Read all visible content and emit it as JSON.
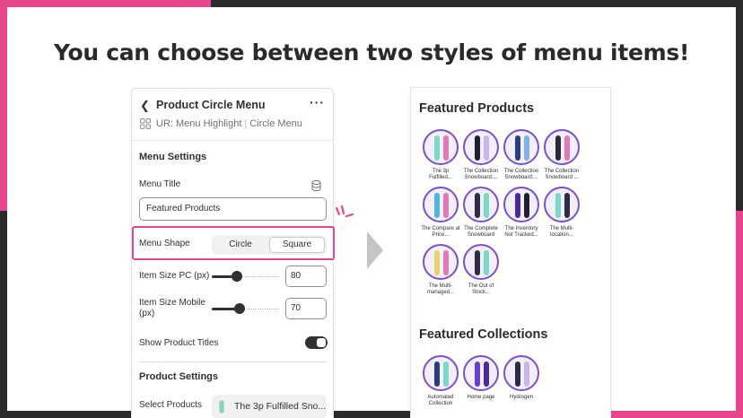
{
  "headline": "You can choose between two styles of menu items!",
  "panel": {
    "title": "Product Circle Menu",
    "subtitle_app": "UR: Menu Highlight",
    "subtitle_block": "Circle Menu",
    "menu_settings": "Menu Settings",
    "menu_title_label": "Menu Title",
    "menu_title_value": "Featured Products",
    "menu_shape_label": "Menu Shape",
    "shape_options": [
      "Circle",
      "Square"
    ],
    "shape_selected": "Square",
    "item_size_pc_label": "Item Size PC (px)",
    "item_size_pc_value": "80",
    "item_size_pc_level": 0.35,
    "item_size_mobile_label": "Item Size Mobile (px)",
    "item_size_mobile_value": "70",
    "item_size_mobile_level": 0.4,
    "show_titles_label": "Show Product Titles",
    "show_titles_on": true,
    "product_settings": "Product Settings",
    "select_products_label": "Select Products",
    "select_products_value": "The 3p Fulfilled Sno..."
  },
  "preview": {
    "featured_products_title": "Featured Products",
    "products": [
      {
        "label": "The 3p Fulfilled...",
        "colors": [
          "#7ad9c4",
          "#e07ab4"
        ]
      },
      {
        "label": "The Collection Snowboard:...",
        "colors": [
          "#1f1f2e",
          "#c9b6e8"
        ]
      },
      {
        "label": "The Collection Snowboard:...",
        "colors": [
          "#2c3e7a",
          "#7fb3e0"
        ]
      },
      {
        "label": "The Collection Snowboard:...",
        "colors": [
          "#2b2b3a",
          "#e07ab4"
        ]
      },
      {
        "label": "The Compare at Price...",
        "colors": [
          "#4fb6e0",
          "#e07ab4"
        ]
      },
      {
        "label": "The Complete Snowboard",
        "colors": [
          "#2c2c44",
          "#7ad9c4"
        ]
      },
      {
        "label": "The Inventory Not Tracked...",
        "colors": [
          "#4a2c99",
          "#1f1f2e"
        ]
      },
      {
        "label": "The Multi-location...",
        "colors": [
          "#7ad9c4",
          "#2c2c44"
        ]
      },
      {
        "label": "The Multi-managed...",
        "colors": [
          "#e8d36b",
          "#e07ab4"
        ]
      },
      {
        "label": "The Out of Stock...",
        "colors": [
          "#2c2c44",
          "#7ad9c4"
        ]
      }
    ],
    "featured_collections_title": "Featured Collections",
    "collections": [
      {
        "label": "Automated Collection",
        "colors": [
          "#2c3e7a",
          "#7ad9c4"
        ]
      },
      {
        "label": "Home page",
        "colors": [
          "#6a3fd0",
          "#4a2c99"
        ]
      },
      {
        "label": "Hydrogen",
        "colors": [
          "#2c2c44",
          "#c9b6e8"
        ]
      }
    ]
  },
  "colors": {
    "accent_pink": "#e8468c",
    "circle_border": "#7a4fd0",
    "text_dark": "#303030"
  }
}
